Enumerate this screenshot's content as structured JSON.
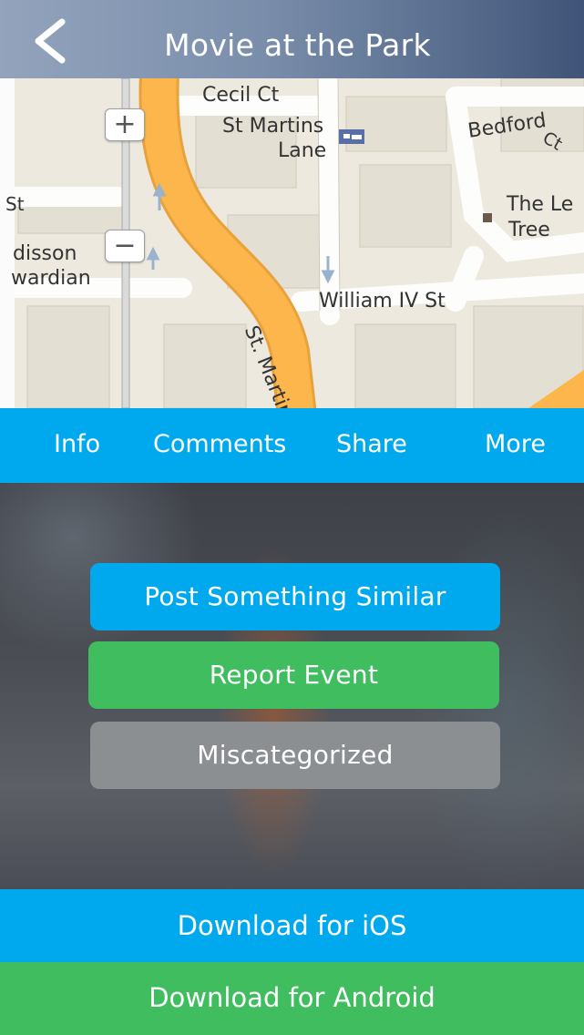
{
  "header": {
    "title": "Movie at the Park",
    "back_icon": "chevron-left-icon"
  },
  "map": {
    "labels": {
      "cecil_ct": "Cecil Ct",
      "st_martins": "St Martins",
      "lane": "Lane",
      "bedford": "Bedford",
      "ct": "Ct",
      "the_le": "The Le",
      "tree": "Tree",
      "st_partial": "St",
      "disson": "disson",
      "wardian": "wardian",
      "william_iv_st": "William IV St",
      "st_martin_road": "St. Martin"
    },
    "zoom_in": "+",
    "zoom_out": "−"
  },
  "tabs": [
    {
      "label": "Info"
    },
    {
      "label": "Comments"
    },
    {
      "label": "Share"
    },
    {
      "label": "More"
    }
  ],
  "actions": {
    "post_similar": "Post Something Similar",
    "report_event": "Report Event",
    "miscategorized": "Miscategorized"
  },
  "downloads": {
    "ios": "Download for iOS",
    "android": "Download for Android"
  },
  "colors": {
    "blue": "#00a9ee",
    "green": "#3fbd5f",
    "gray": "#8c8f92",
    "road_yellow": "#fcb64b"
  }
}
